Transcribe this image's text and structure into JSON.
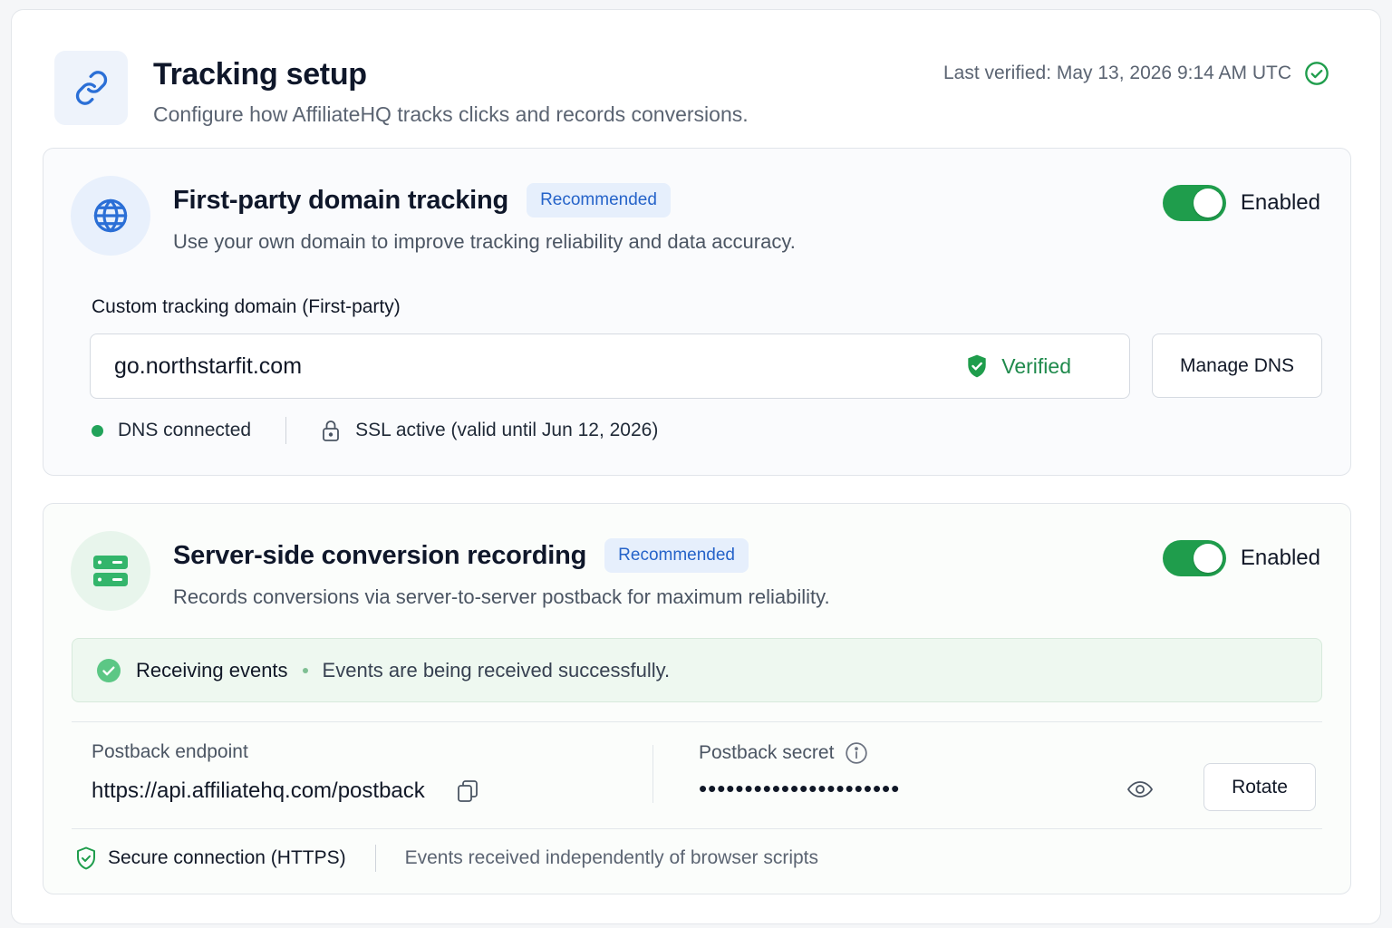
{
  "header": {
    "title": "Tracking setup",
    "subtitle": "Configure how AffiliateHQ tracks clicks and records conversions.",
    "last_verified": "Last verified: May 13, 2026 9:14 AM UTC",
    "header_icon": "link-icon",
    "verified_icon": "check-circle-icon"
  },
  "first_party": {
    "icon": "globe-icon",
    "title": "First-party domain tracking",
    "badge": "Recommended",
    "description": "Use your own domain to improve tracking reliability and data accuracy.",
    "toggle_label": "Enabled",
    "toggle_on": true,
    "field_label": "Custom tracking domain (First-party)",
    "domain_value": "go.northstarfit.com",
    "verified_label": "Verified",
    "manage_dns_label": "Manage DNS",
    "dns_status": "DNS connected",
    "ssl_status": "SSL active (valid until Jun 12, 2026)"
  },
  "server_side": {
    "icon": "server-icon",
    "title": "Server-side conversion recording",
    "badge": "Recommended",
    "description": "Records conversions via server-to-server postback for maximum reliability.",
    "toggle_label": "Enabled",
    "toggle_on": true,
    "events_status": "Receiving events",
    "events_message": "Events are being received successfully.",
    "endpoint_label": "Postback endpoint",
    "endpoint_value": "https://api.affiliatehq.com/postback",
    "secret_label": "Postback secret",
    "secret_value": "••••••••••••••••••••••",
    "rotate_label": "Rotate",
    "secure_connection": "Secure connection (HTTPS)",
    "independent_note": "Events received independently of browser scripts"
  },
  "colors": {
    "accent_blue": "#2563c9",
    "success_green": "#1f9d4c",
    "badge_bg": "#e6effc"
  }
}
